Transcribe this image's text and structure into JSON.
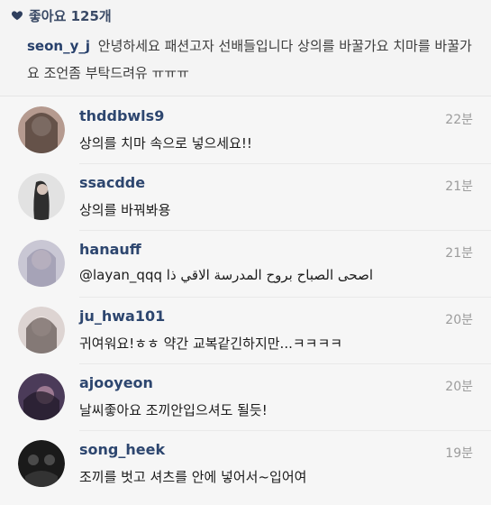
{
  "post": {
    "likes_label": "좋아요 125개",
    "caption_user": "seon_y_j",
    "caption_text": "안녕하세요 패션고자 선배들입니다 상의를 바꿀가요 치마를 바꿀가요 조언좀 부탁드려유 ㅠㅠㅠ"
  },
  "comments": [
    {
      "username": "thddbwls9",
      "text": "상의를 치마 속으로 넣으세요!!",
      "time": "22분",
      "avatar_color": "#b59a8f"
    },
    {
      "username": "ssacdde",
      "text": "상의를 바꿔봐용",
      "time": "21분",
      "avatar_color": "#2e2e2e"
    },
    {
      "username": "hanauff",
      "text": "@layan_qqq اصحى الصباح بروح المدرسة الاقي ذا",
      "time": "21분",
      "avatar_color": "#a8a3b6"
    },
    {
      "username": "ju_hwa101",
      "text": "귀여워요!ㅎㅎ 약간 교복같긴하지만...ㅋㅋㅋㅋ",
      "time": "20분",
      "avatar_color": "#d2c5c1"
    },
    {
      "username": "ajooyeon",
      "text": "날씨좋아요 조끼안입으셔도 될듯!",
      "time": "20분",
      "avatar_color": "#4b3b59"
    },
    {
      "username": "song_heek",
      "text": "조끼를 벗고 셔츠를 안에 넣어서~입어여",
      "time": "19분",
      "avatar_color": "#1a1a1a"
    }
  ]
}
